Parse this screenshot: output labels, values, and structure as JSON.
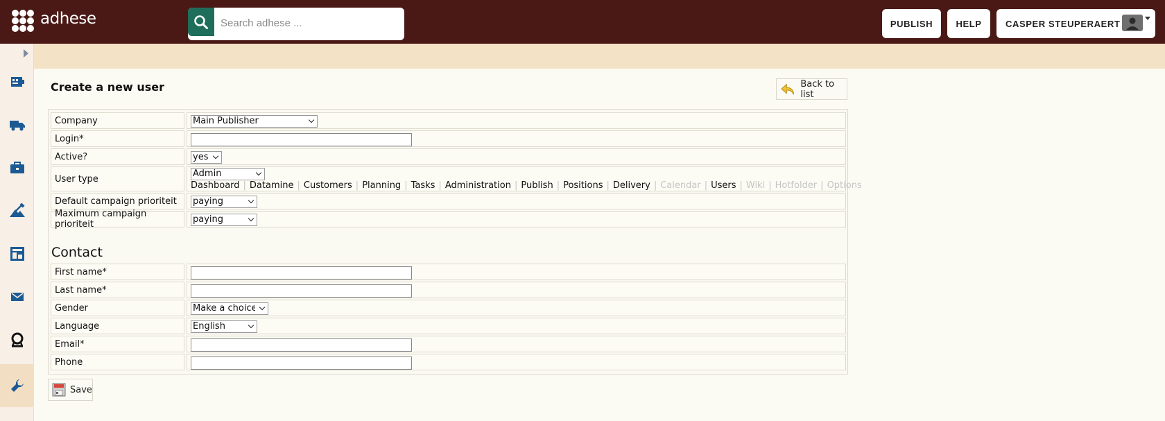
{
  "header": {
    "logo_text": "adhese",
    "search": {
      "placeholder": "Search adhese ..."
    },
    "publish_label": "PUBLISH",
    "help_label": "HELP",
    "user_name": "CASPER STEUPERAERT"
  },
  "sidebar": {
    "items": [
      {
        "icon": "inventory-icon"
      },
      {
        "icon": "truck-icon"
      },
      {
        "icon": "briefcase-icon"
      },
      {
        "icon": "tools-icon"
      },
      {
        "icon": "layout-icon"
      },
      {
        "icon": "mail-icon"
      },
      {
        "icon": "camera-icon"
      },
      {
        "icon": "wrench-icon",
        "active": true
      }
    ]
  },
  "page": {
    "title": "Create a new user",
    "back_label": "Back to list",
    "save_label": "Save"
  },
  "form": {
    "company_label": "Company",
    "company_value": "Main Publisher",
    "login_label": "Login*",
    "active_label": "Active?",
    "active_value": "yes",
    "user_type_label": "User type",
    "user_type_value": "Admin",
    "permissions": [
      {
        "label": "Dashboard",
        "enabled": true
      },
      {
        "label": "Datamine",
        "enabled": true
      },
      {
        "label": "Customers",
        "enabled": true
      },
      {
        "label": "Planning",
        "enabled": true
      },
      {
        "label": "Tasks",
        "enabled": true
      },
      {
        "label": "Administration",
        "enabled": true
      },
      {
        "label": "Publish",
        "enabled": true
      },
      {
        "label": "Positions",
        "enabled": true
      },
      {
        "label": "Delivery",
        "enabled": true
      },
      {
        "label": "Calendar",
        "enabled": false
      },
      {
        "label": "Users",
        "enabled": true
      },
      {
        "label": "Wiki",
        "enabled": false
      },
      {
        "label": "Hotfolder",
        "enabled": false
      },
      {
        "label": "Options",
        "enabled": false
      }
    ],
    "default_prio_label": "Default campaign prioriteit",
    "default_prio_value": "paying",
    "max_prio_label": "Maximum campaign prioriteit",
    "max_prio_value": "paying"
  },
  "contact": {
    "heading": "Contact",
    "first_name_label": "First name*",
    "last_name_label": "Last name*",
    "gender_label": "Gender",
    "gender_value": "Make a choice",
    "language_label": "Language",
    "language_value": "English",
    "email_label": "Email*",
    "phone_label": "Phone"
  },
  "colors": {
    "header_bg": "#4a1915",
    "search_btn": "#1f6e5b",
    "top_band": "#f3e2c6",
    "content_bg": "#fcfbf3",
    "icon_blue": "#1c5a94"
  }
}
